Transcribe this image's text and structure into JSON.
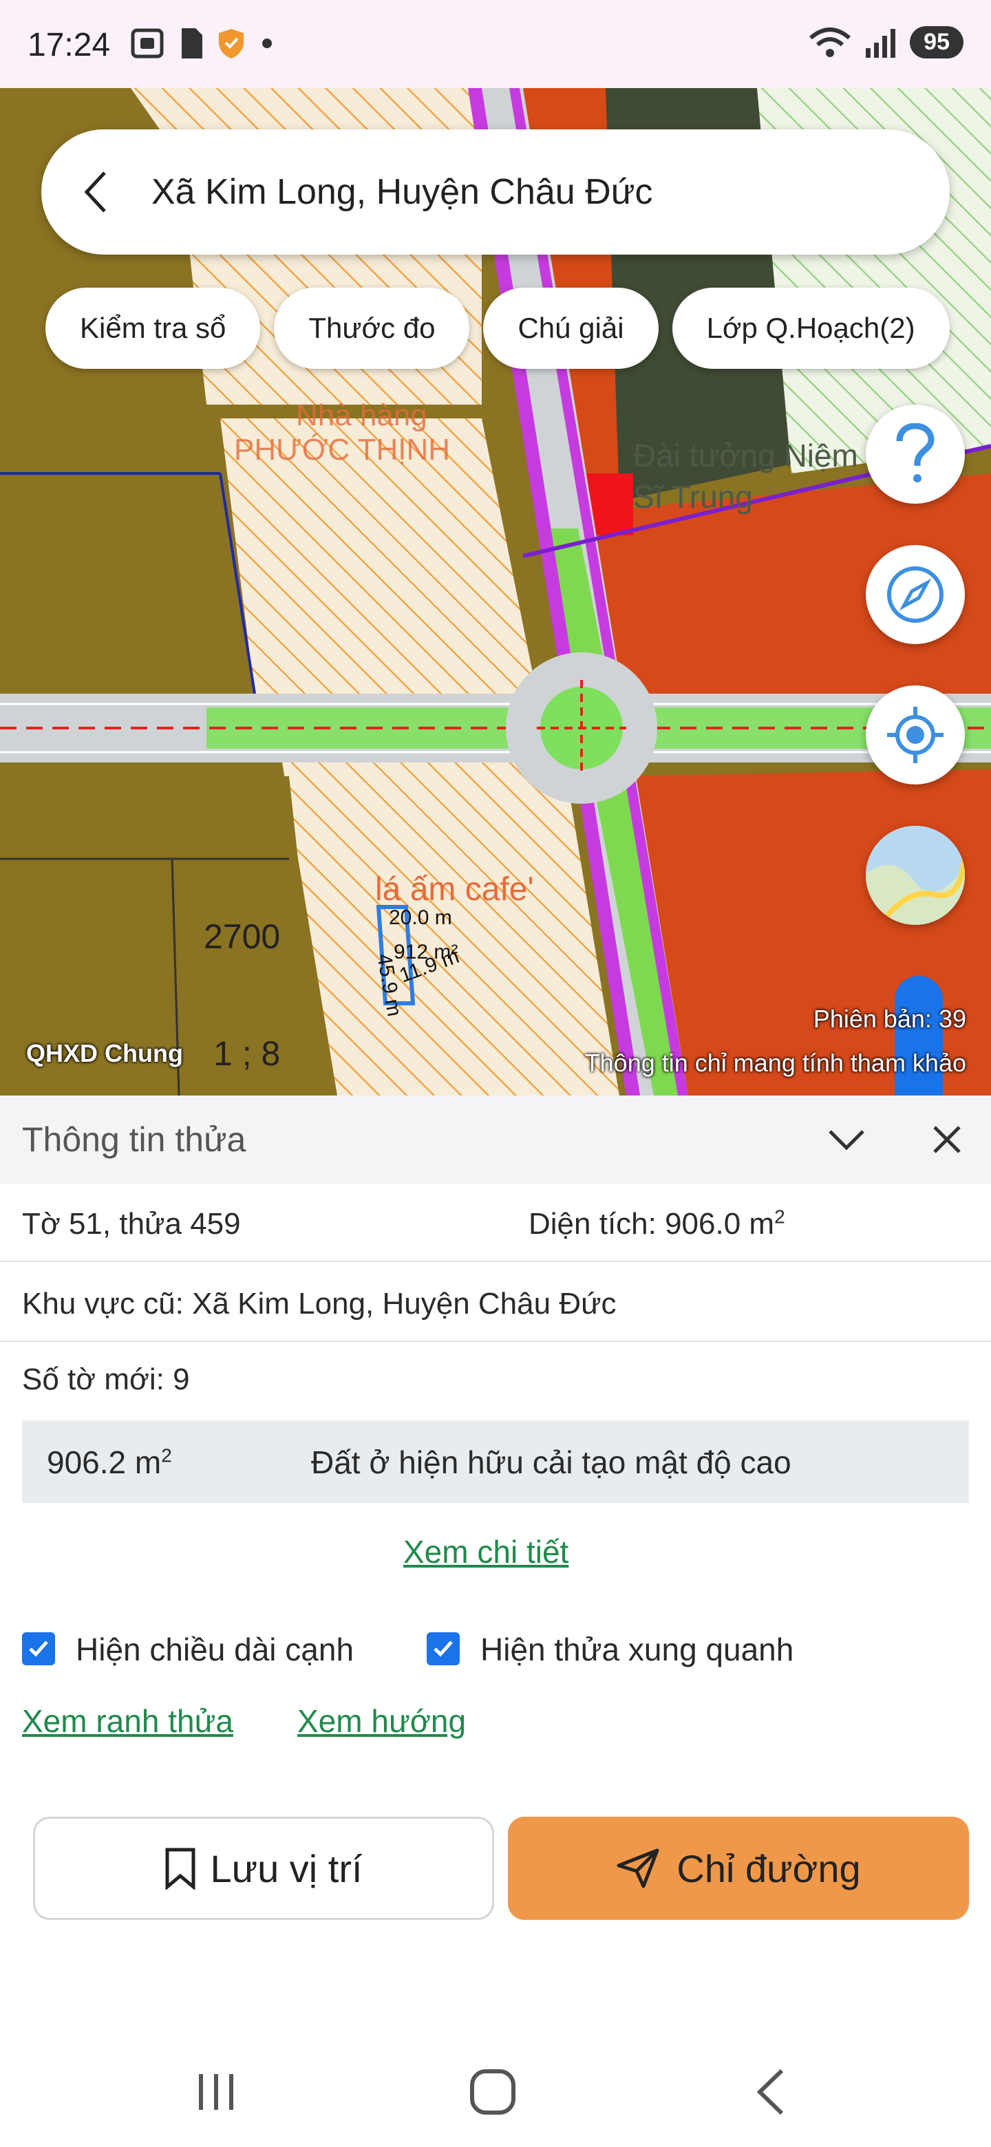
{
  "status_bar": {
    "time": "17:24",
    "battery": "95",
    "icons_left": [
      "screenshot-icon",
      "sim-card-icon",
      "shield-icon",
      "dot-icon"
    ],
    "icons_right": [
      "wifi-icon",
      "signal-icon",
      "battery-icon"
    ]
  },
  "header": {
    "title": "Xã Kim Long, Huyện Châu Đức"
  },
  "chips": [
    {
      "label": "Kiểm tra sổ"
    },
    {
      "label": "Thước đo"
    },
    {
      "label": "Chú giải"
    },
    {
      "label": "Lớp Q.Hoạch(2)"
    }
  ],
  "map": {
    "layer_label": "QHXD Chung",
    "version": "Phiên bản: 39",
    "note": "Thông tin chỉ mang tính tham khảo",
    "place_labels": [
      "Nhà hàng",
      "PHƯỚC THỊNH",
      "Đài tưởng Niệm",
      "Sĩ Trung",
      "lá ấm cafe'",
      "2700",
      "1 ; 8"
    ],
    "measurements": [
      "20.0 m",
      "912 m²",
      "11.9 m",
      "45.9 m"
    ]
  },
  "panel": {
    "title": "Thông tin thửa",
    "sheet_parcel": "Tờ 51, thửa 459",
    "area_label": "Diện tích: 906.0 m",
    "area_sup": "2",
    "old_area_label": "Khu vực cũ: Xã Kim Long, Huyện Châu Đức",
    "new_sheet_label": "Số tờ mới: 9",
    "landuse": {
      "area": "906.2 m",
      "area_sup": "2",
      "type": "Đất ở hiện hữu cải tạo mật độ cao"
    },
    "view_detail": "Xem chi tiết",
    "checkboxes": [
      {
        "label": "Hiện chiều dài cạnh",
        "checked": true
      },
      {
        "label": "Hiện thửa xung quanh",
        "checked": true
      }
    ],
    "links": [
      "Xem ranh thửa",
      "Xem hướng"
    ],
    "save_button": "Lưu vị trí",
    "route_button": "Chỉ đường"
  },
  "colors": {
    "accent_orange": "#f0984a",
    "link_green": "#1f8a4c",
    "checkbox_blue": "#1a73e8",
    "fab_blue": "#4a90d9"
  }
}
